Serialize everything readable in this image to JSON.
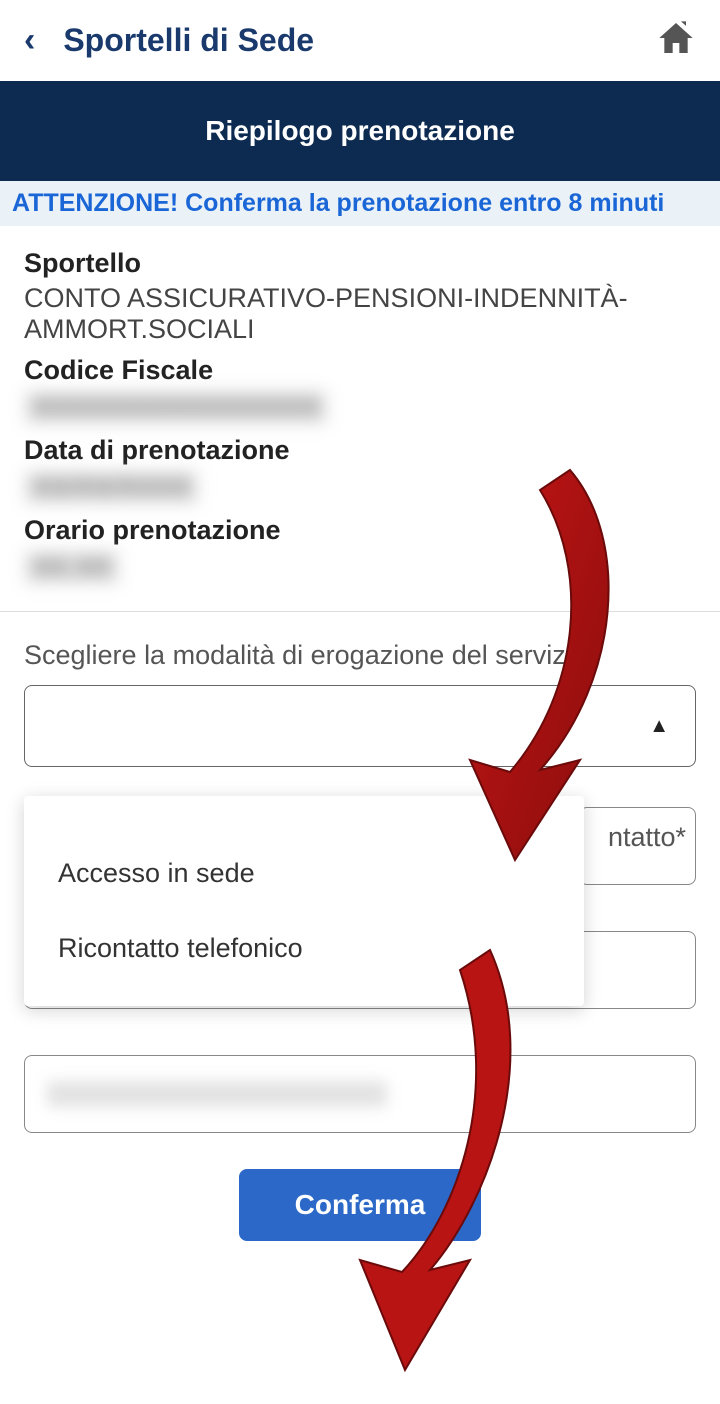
{
  "header": {
    "title": "Sportelli di Sede"
  },
  "banner": "Riepilogo prenotazione",
  "alert": "ATTENZIONE! Conferma la prenotazione entro 8 minuti",
  "summary": {
    "sportello_label": "Sportello",
    "sportello_value": "CONTO ASSICURATIVO-PENSIONI-INDENNITÀ-AMMORT.SOCIALI",
    "cf_label": "Codice Fiscale",
    "cf_value": "XXXXXXXXXXXXXXXX",
    "data_label": "Data di prenotazione",
    "data_value": "XX/XX/XXXX",
    "orario_label": "Orario prenotazione",
    "orario_value": "XX:XX"
  },
  "form": {
    "mode_label": "Scegliere la modalità di erogazione del servizio",
    "contact_label_fragment": "ntatto*",
    "options": {
      "opt1": "Accesso in sede",
      "opt2": "Ricontatto telefonico"
    }
  },
  "confirm": "Conferma"
}
